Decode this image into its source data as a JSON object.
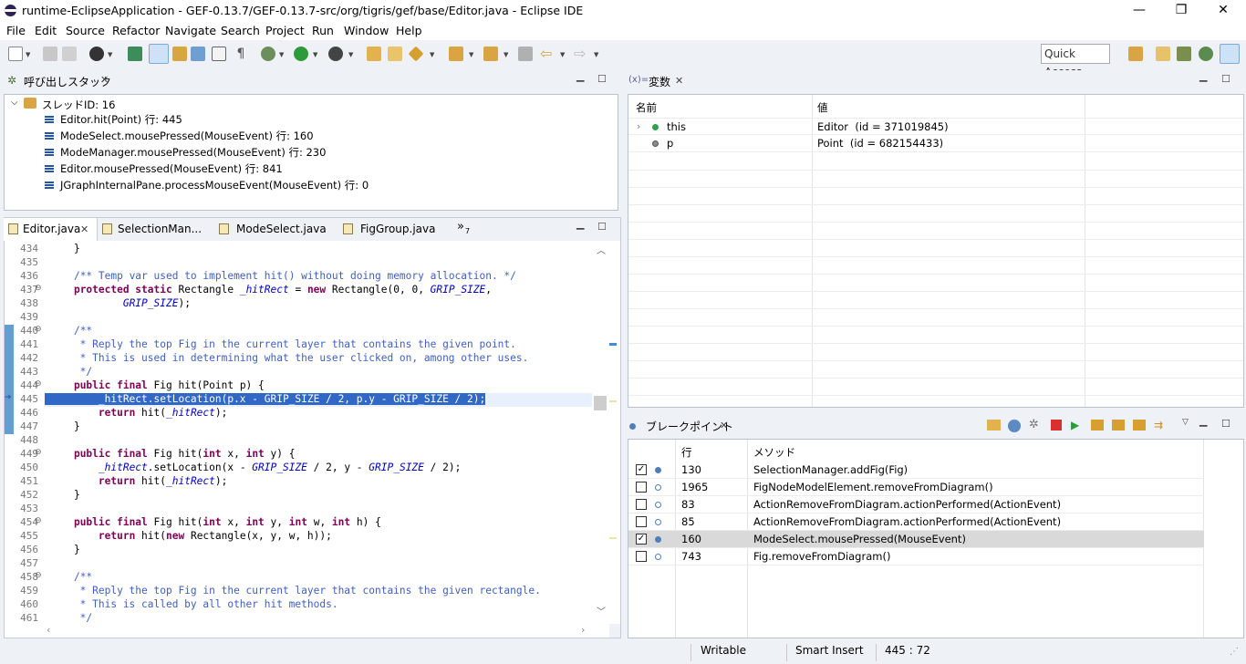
{
  "window": {
    "title": "runtime-EclipseApplication - GEF-0.13.7/GEF-0.13.7-src/org/tigris/gef/base/Editor.java - Eclipse IDE",
    "minimize": "—",
    "restore": "❐",
    "close": "✕"
  },
  "menu": [
    "File",
    "Edit",
    "Source",
    "Refactor",
    "Navigate",
    "Search",
    "Project",
    "Run",
    "Window",
    "Help"
  ],
  "toolbar": {
    "quick_access": "Quick Access",
    "icons": [
      "new-icon",
      "save-icon",
      "save-all-icon",
      "profile-icon",
      "skip-breakpoints-icon",
      "highlight-icon",
      "open-type-icon",
      "task-icon",
      "pilcrow-icon",
      "debug-icon",
      "run-icon",
      "coverage-icon",
      "open-folder-icon",
      "open-file-icon",
      "search-icon",
      "next-annotation-icon",
      "prev-annotation-icon",
      "last-edit-icon",
      "back-icon",
      "forward-icon",
      "perspective-open-icon",
      "perspective-java-icon",
      "perspective-git-icon",
      "perspective-debug-icon",
      "perspective-resource-icon"
    ]
  },
  "call_stack": {
    "title": "呼び出しスタック",
    "thread": "スレッドID: 16",
    "frames": [
      "Editor.hit(Point) 行: 445",
      "ModeSelect.mousePressed(MouseEvent) 行: 160",
      "ModeManager.mousePressed(MouseEvent) 行: 230",
      "Editor.mousePressed(MouseEvent) 行: 841",
      "JGraphInternalPane.processMouseEvent(MouseEvent) 行: 0"
    ]
  },
  "editor": {
    "tabs": [
      "Editor.java",
      "SelectionMan...",
      "ModeSelect.java",
      "FigGroup.java"
    ],
    "overflow": "»",
    "overflow_count": "7",
    "lines": [
      {
        "n": "434",
        "fold": "",
        "html": "    }"
      },
      {
        "n": "435",
        "fold": "",
        "html": ""
      },
      {
        "n": "436",
        "fold": "",
        "html": "    <span class=\"cm\">/** Temp var used to implement hit() without doing memory allocation. */</span>"
      },
      {
        "n": "437",
        "fold": "⊖",
        "html": "    <span class=\"kw\">protected static</span> Rectangle <span class=\"fi\">_hitRect</span> = <span class=\"kw\">new</span> Rectangle(0, 0, <span class=\"fi\">GRIP_SIZE</span>,"
      },
      {
        "n": "438",
        "fold": "",
        "html": "            <span class=\"fi\">GRIP_SIZE</span>);"
      },
      {
        "n": "439",
        "fold": "",
        "html": ""
      },
      {
        "n": "440",
        "fold": "⊖",
        "html": "    <span class=\"cm\">/**</span>"
      },
      {
        "n": "441",
        "fold": "",
        "html": "<span class=\"cm\">     * Reply the top Fig in the current layer that contains the given point.</span>"
      },
      {
        "n": "442",
        "fold": "",
        "html": "<span class=\"cm\">     * This is used in determining what the user clicked on, among other uses.</span>"
      },
      {
        "n": "443",
        "fold": "",
        "html": "<span class=\"cm\">     */</span>"
      },
      {
        "n": "444",
        "fold": "⊖",
        "html": "    <span class=\"kw\">public final</span> Fig hit(Point p) {"
      },
      {
        "n": "445",
        "fold": "",
        "html": "        _hitRect.setLocation(p.x - GRIP_SIZE / 2, p.y - GRIP_SIZE / 2);"
      },
      {
        "n": "446",
        "fold": "",
        "html": "        <span class=\"kw\">return</span> hit(<span class=\"fi\">_hitRect</span>);"
      },
      {
        "n": "447",
        "fold": "",
        "html": "    }"
      },
      {
        "n": "448",
        "fold": "",
        "html": ""
      },
      {
        "n": "449",
        "fold": "⊖",
        "html": "    <span class=\"kw\">public final</span> Fig hit(<span class=\"kw\">int</span> x, <span class=\"kw\">int</span> y) {"
      },
      {
        "n": "450",
        "fold": "",
        "html": "        <span class=\"fi\">_hitRect</span>.setLocation(x - <span class=\"fi\">GRIP_SIZE</span> / 2, y - <span class=\"fi\">GRIP_SIZE</span> / 2);"
      },
      {
        "n": "451",
        "fold": "",
        "html": "        <span class=\"kw\">return</span> hit(<span class=\"fi\">_hitRect</span>);"
      },
      {
        "n": "452",
        "fold": "",
        "html": "    }"
      },
      {
        "n": "453",
        "fold": "",
        "html": ""
      },
      {
        "n": "454",
        "fold": "⊖",
        "html": "    <span class=\"kw\">public final</span> Fig hit(<span class=\"kw\">int</span> x, <span class=\"kw\">int</span> y, <span class=\"kw\">int</span> w, <span class=\"kw\">int</span> h) {"
      },
      {
        "n": "455",
        "fold": "",
        "html": "        <span class=\"kw\">return</span> hit(<span class=\"kw\">new</span> Rectangle(x, y, w, h));"
      },
      {
        "n": "456",
        "fold": "",
        "html": "    }"
      },
      {
        "n": "457",
        "fold": "",
        "html": ""
      },
      {
        "n": "458",
        "fold": "⊖",
        "html": "    <span class=\"cm\">/**</span>"
      },
      {
        "n": "459",
        "fold": "",
        "html": "<span class=\"cm\">     * Reply the top Fig in the current layer that contains the given rectangle.</span>"
      },
      {
        "n": "460",
        "fold": "",
        "html": "<span class=\"cm\">     * This is called by all other hit methods.</span>"
      },
      {
        "n": "461",
        "fold": "",
        "html": "<span class=\"cm\">     */</span>"
      }
    ]
  },
  "variables": {
    "title": "変数",
    "title_prefix": "(x)=",
    "col_name": "名前",
    "col_value": "値",
    "rows": [
      {
        "name": "this",
        "value": "Editor  (id = 371019845)"
      },
      {
        "name": "p",
        "value": "Point  (id = 682154433)"
      }
    ]
  },
  "breakpoints": {
    "title": "ブレークポイント",
    "col_line": "行",
    "col_method": "メソッド",
    "rows": [
      {
        "checked": "✓",
        "line": "130",
        "method": "SelectionManager.addFig(Fig)"
      },
      {
        "checked": "",
        "line": "1965",
        "method": "FigNodeModelElement.removeFromDiagram()"
      },
      {
        "checked": "",
        "line": "83",
        "method": "ActionRemoveFromDiagram.actionPerformed(ActionEvent)"
      },
      {
        "checked": "",
        "line": "85",
        "method": "ActionRemoveFromDiagram.actionPerformed(ActionEvent)"
      },
      {
        "checked": "✓",
        "line": "160",
        "method": "ModeSelect.mousePressed(MouseEvent)"
      },
      {
        "checked": "",
        "line": "743",
        "method": "Fig.removeFromDiagram()"
      }
    ]
  },
  "status": {
    "writable": "Writable",
    "insert": "Smart Insert",
    "position": "445 : 72"
  }
}
